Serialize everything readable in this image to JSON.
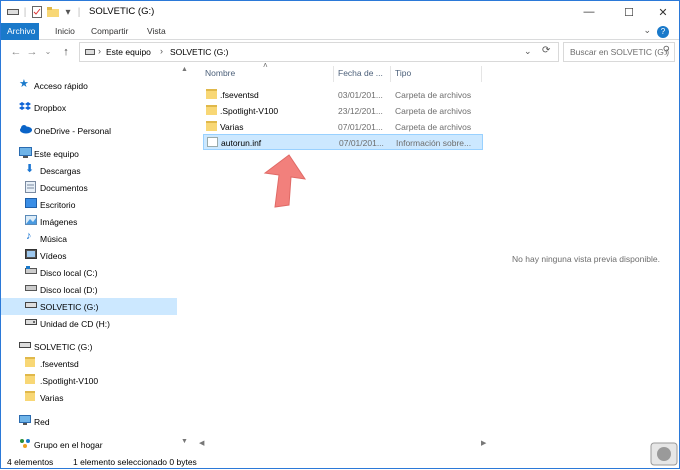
{
  "titlebar": {
    "title": "SOLVETIC (G:)",
    "minimize": "—",
    "maximize": "☐",
    "close": "✕"
  },
  "ribbon": {
    "tabs": [
      "Archivo",
      "Inicio",
      "Compartir",
      "Vista"
    ],
    "help": "?"
  },
  "address": {
    "parts": [
      "Este equipo",
      "SOLVETIC (G:)"
    ],
    "search_placeholder": "Buscar en SOLVETIC (G:)"
  },
  "nav": {
    "items": [
      {
        "label": "Acceso rápido",
        "icon": "star-icon"
      },
      {
        "label": "Dropbox",
        "icon": "dropbox-icon"
      },
      {
        "label": "OneDrive - Personal",
        "icon": "cloud-icon"
      },
      {
        "label": "Este equipo",
        "icon": "computer-icon"
      },
      {
        "label": "Descargas",
        "icon": "download-icon"
      },
      {
        "label": "Documentos",
        "icon": "documents-icon"
      },
      {
        "label": "Escritorio",
        "icon": "desktop-icon"
      },
      {
        "label": "Imágenes",
        "icon": "pictures-icon"
      },
      {
        "label": "Música",
        "icon": "music-icon"
      },
      {
        "label": "Vídeos",
        "icon": "videos-icon"
      },
      {
        "label": "Disco local (C:)",
        "icon": "drive-icon"
      },
      {
        "label": "Disco local (D:)",
        "icon": "drive-icon"
      },
      {
        "label": "SOLVETIC (G:)",
        "icon": "usb-drive-icon"
      },
      {
        "label": "Unidad de CD (H:)",
        "icon": "cd-drive-icon"
      },
      {
        "label": "SOLVETIC (G:)",
        "icon": "usb-drive-icon"
      },
      {
        "label": ".fseventsd",
        "icon": "folder-icon"
      },
      {
        "label": ".Spotlight-V100",
        "icon": "folder-icon"
      },
      {
        "label": "Varias",
        "icon": "folder-icon"
      },
      {
        "label": "Red",
        "icon": "network-icon"
      },
      {
        "label": "Grupo en el hogar",
        "icon": "homegroup-icon"
      }
    ]
  },
  "columns": {
    "name": "Nombre",
    "date": "Fecha de ...",
    "type": "Tipo"
  },
  "files": [
    {
      "name": ".fseventsd",
      "date": "03/01/201...",
      "type": "Carpeta de archivos",
      "icon": "folder-icon"
    },
    {
      "name": ".Spotlight-V100",
      "date": "23/12/201...",
      "type": "Carpeta de archivos",
      "icon": "folder-icon"
    },
    {
      "name": "Varias",
      "date": "07/01/201...",
      "type": "Carpeta de archivos",
      "icon": "folder-icon"
    },
    {
      "name": "autorun.inf",
      "date": "07/01/201...",
      "type": "Información sobre...",
      "icon": "inf-file-icon"
    }
  ],
  "preview": {
    "message": "No hay ninguna vista previa disponible."
  },
  "status": {
    "count": "4 elementos",
    "selection": "1 elemento seleccionado  0 bytes"
  },
  "colors": {
    "accent": "#1979ca",
    "selected_bg": "#cce8ff",
    "arrow": "#f2807c"
  }
}
